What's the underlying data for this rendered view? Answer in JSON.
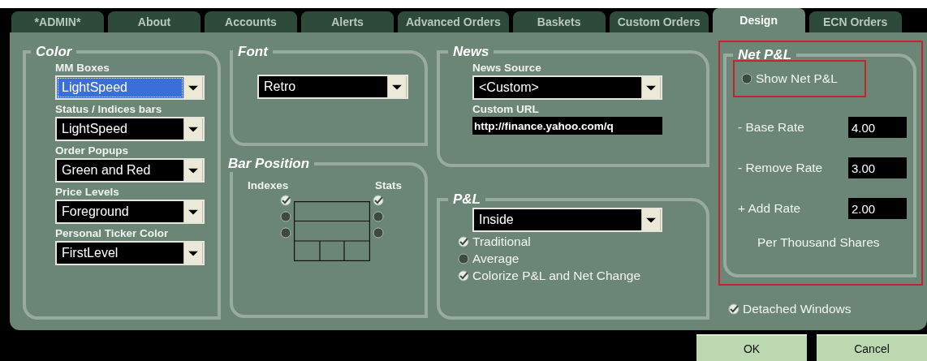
{
  "tabs": [
    {
      "label": "*ADMIN*",
      "selected": false
    },
    {
      "label": "About",
      "selected": false
    },
    {
      "label": "Accounts",
      "selected": false
    },
    {
      "label": "Alerts",
      "selected": false
    },
    {
      "label": "Advanced Orders",
      "selected": false
    },
    {
      "label": "Baskets",
      "selected": false
    },
    {
      "label": "Custom Orders",
      "selected": false
    },
    {
      "label": "Design",
      "selected": true
    },
    {
      "label": "ECN Orders",
      "selected": false
    }
  ],
  "color_group": {
    "title": "Color",
    "fields": [
      {
        "label": "MM Boxes",
        "value": "LightSpeed",
        "focused": true
      },
      {
        "label": "Status / Indices bars",
        "value": "LightSpeed",
        "focused": false
      },
      {
        "label": "Order Popups",
        "value": "Green and Red",
        "focused": false
      },
      {
        "label": "Price Levels",
        "value": "Foreground",
        "focused": false
      },
      {
        "label": "Personal Ticker Color",
        "value": "FirstLevel",
        "focused": false
      }
    ]
  },
  "font_group": {
    "title": "Font",
    "value": "Retro"
  },
  "bar_position": {
    "title": "Bar Position",
    "left_label": "Indexes",
    "right_label": "Stats",
    "indexes": [
      {
        "checked": true
      },
      {
        "checked": false
      },
      {
        "checked": false
      }
    ],
    "stats": [
      {
        "checked": true
      },
      {
        "checked": false
      },
      {
        "checked": false
      }
    ]
  },
  "news": {
    "title": "News",
    "source_label": "News Source",
    "source_value": "<Custom>",
    "url_label": "Custom URL",
    "url_value": "http://finance.yahoo.com/q"
  },
  "pnl": {
    "title": "P&L",
    "value": "Inside",
    "options": [
      {
        "label": "Traditional",
        "checked": true
      },
      {
        "label": "Average",
        "checked": false
      },
      {
        "label": "Colorize P&L and Net Change",
        "checked": true
      }
    ]
  },
  "net_pnl": {
    "title": "Net P&L",
    "show": {
      "label": "Show Net P&L",
      "checked": false
    },
    "rates": [
      {
        "label": "- Base Rate",
        "value": "4.00"
      },
      {
        "label": "- Remove Rate",
        "value": "3.00"
      },
      {
        "label": "+ Add Rate",
        "value": "2.00"
      }
    ],
    "note": "Per Thousand Shares"
  },
  "detached_windows": {
    "label": "Detached Windows",
    "checked": true
  },
  "buttons": [
    "OK",
    "Cancel"
  ]
}
